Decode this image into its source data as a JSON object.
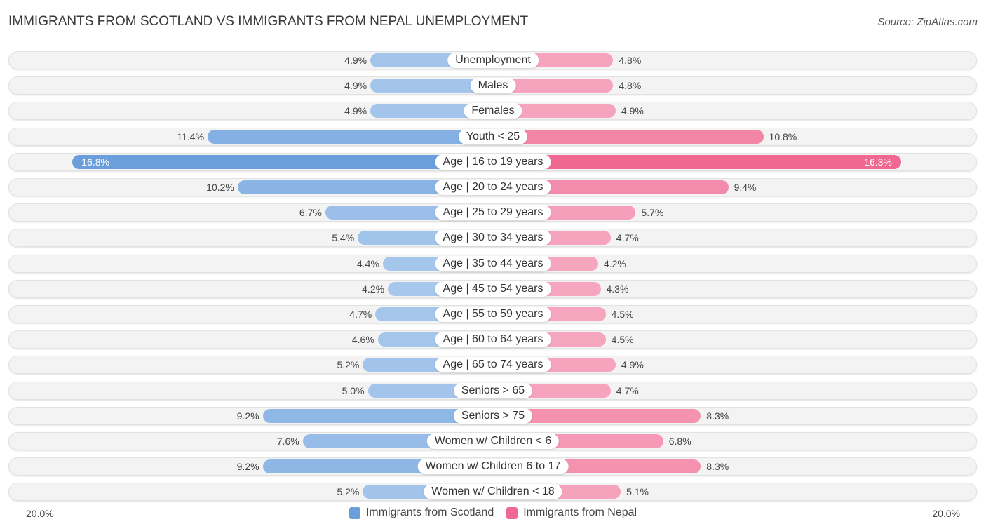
{
  "header": {
    "title": "IMMIGRANTS FROM SCOTLAND VS IMMIGRANTS FROM NEPAL UNEMPLOYMENT",
    "source": "Source: ZipAtlas.com"
  },
  "colors": {
    "scotland": "#a8c8ec",
    "scotland_strong": "#6a9fdc",
    "nepal": "#f6a8c0",
    "nepal_strong": "#f06892",
    "legend_scotland": "#6a9fdc",
    "legend_nepal": "#f06892"
  },
  "chart_data": {
    "type": "bar",
    "orientation": "horizontal-diverging",
    "title": "IMMIGRANTS FROM SCOTLAND VS IMMIGRANTS FROM NEPAL UNEMPLOYMENT",
    "xlim": [
      -20,
      20
    ],
    "axis_left_label": "20.0%",
    "axis_right_label": "20.0%",
    "legend_position": "bottom-center",
    "categories": [
      "Unemployment",
      "Males",
      "Females",
      "Youth < 25",
      "Age | 16 to 19 years",
      "Age | 20 to 24 years",
      "Age | 25 to 29 years",
      "Age | 30 to 34 years",
      "Age | 35 to 44 years",
      "Age | 45 to 54 years",
      "Age | 55 to 59 years",
      "Age | 60 to 64 years",
      "Age | 65 to 74 years",
      "Seniors > 65",
      "Seniors > 75",
      "Women w/ Children < 6",
      "Women w/ Children 6 to 17",
      "Women w/ Children < 18"
    ],
    "series": [
      {
        "name": "Immigrants from Scotland",
        "side": "left",
        "values": [
          4.9,
          4.9,
          4.9,
          11.4,
          16.8,
          10.2,
          6.7,
          5.4,
          4.4,
          4.2,
          4.7,
          4.6,
          5.2,
          5.0,
          9.2,
          7.6,
          9.2,
          5.2
        ],
        "labels": [
          "4.9%",
          "4.9%",
          "4.9%",
          "11.4%",
          "16.8%",
          "10.2%",
          "6.7%",
          "5.4%",
          "4.4%",
          "4.2%",
          "4.7%",
          "4.6%",
          "5.2%",
          "5.0%",
          "9.2%",
          "7.6%",
          "9.2%",
          "5.2%"
        ]
      },
      {
        "name": "Immigrants from Nepal",
        "side": "right",
        "values": [
          4.8,
          4.8,
          4.9,
          10.8,
          16.3,
          9.4,
          5.7,
          4.7,
          4.2,
          4.3,
          4.5,
          4.5,
          4.9,
          4.7,
          8.3,
          6.8,
          8.3,
          5.1
        ],
        "labels": [
          "4.8%",
          "4.8%",
          "4.9%",
          "10.8%",
          "16.3%",
          "9.4%",
          "5.7%",
          "4.7%",
          "4.2%",
          "4.3%",
          "4.5%",
          "4.5%",
          "4.9%",
          "4.7%",
          "8.3%",
          "6.8%",
          "8.3%",
          "5.1%"
        ]
      }
    ]
  },
  "legend": {
    "items": [
      {
        "label": "Immigrants from Scotland"
      },
      {
        "label": "Immigrants from Nepal"
      }
    ]
  }
}
